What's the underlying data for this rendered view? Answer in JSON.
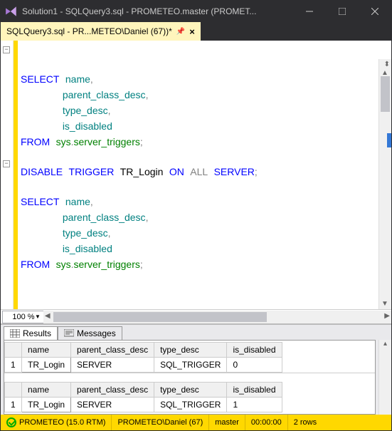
{
  "window": {
    "title": "Solution1 - SQLQuery3.sql - PROMETEO.master (PROMET..."
  },
  "tab": {
    "label": "SQLQuery3.sql - PR...METEO\\Daniel (67))*"
  },
  "editor": {
    "line1_kw": "SELECT",
    "line1_col": "name",
    "line2": "parent_class_desc",
    "line3": "type_desc",
    "line4": "is_disabled",
    "line5_kw": "FROM",
    "line5_schema": "sys",
    "line5_obj": "server_triggers",
    "line6_kw1": "DISABLE",
    "line6_kw2": "TRIGGER",
    "line6_name": "TR_Login",
    "line6_kw3": "ON",
    "line6_kw4": "ALL",
    "line6_kw5": "SERVER",
    "zoom": "100 %"
  },
  "results": {
    "tab_results": "Results",
    "tab_messages": "Messages",
    "columns": {
      "c0": "name",
      "c1": "parent_class_desc",
      "c2": "type_desc",
      "c3": "is_disabled"
    },
    "row_idx": "1",
    "set1": {
      "name": "TR_Login",
      "parent": "SERVER",
      "type": "SQL_TRIGGER",
      "disabled": "0"
    },
    "set2": {
      "name": "TR_Login",
      "parent": "SERVER",
      "type": "SQL_TRIGGER",
      "disabled": "1"
    }
  },
  "status": {
    "server": "PROMETEO (15.0 RTM)",
    "user": "PROMETEO\\Daniel (67)",
    "db": "master",
    "time": "00:00:00",
    "rows": "2 rows"
  }
}
